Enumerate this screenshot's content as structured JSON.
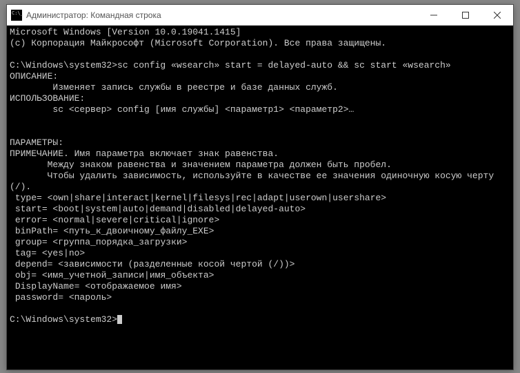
{
  "window": {
    "title": "Администратор: Командная строка"
  },
  "terminal": {
    "lines": [
      "Microsoft Windows [Version 10.0.19041.1415]",
      "(c) Корпорация Майкрософт (Microsoft Corporation). Все права защищены.",
      "",
      "C:\\Windows\\system32>sc config «wsearch» start = delayed-auto && sc start «wsearch»",
      "ОПИСАНИЕ:",
      "        Изменяет запись службы в реестре и базе данных служб.",
      "ИСПОЛЬЗОВАНИЕ:",
      "        sc <сервер> config [имя службы] <параметр1> <параметр2>…",
      "",
      "",
      "ПАРАМЕТРЫ:",
      "ПРИМЕЧАНИЕ. Имя параметра включает знак равенства.",
      "       Между знаком равенства и значением параметра должен быть пробел.",
      "       Чтобы удалить зависимость, используйте в качестве ее значения одиночную косую черту (/).",
      " type= <own|share|interact|kernel|filesys|rec|adapt|userown|usershare>",
      " start= <boot|system|auto|demand|disabled|delayed-auto>",
      " error= <normal|severe|critical|ignore>",
      " binPath= <путь_к_двоичному_файлу_EXE>",
      " group= <группа_порядка_загрузки>",
      " tag= <yes|no>",
      " depend= <зависимости (разделенные косой чертой (/))>",
      " obj= <имя_учетной_записи|имя_объекта>",
      " DisplayName= <отображаемое имя>",
      " password= <пароль>",
      ""
    ],
    "prompt": "C:\\Windows\\system32>"
  }
}
